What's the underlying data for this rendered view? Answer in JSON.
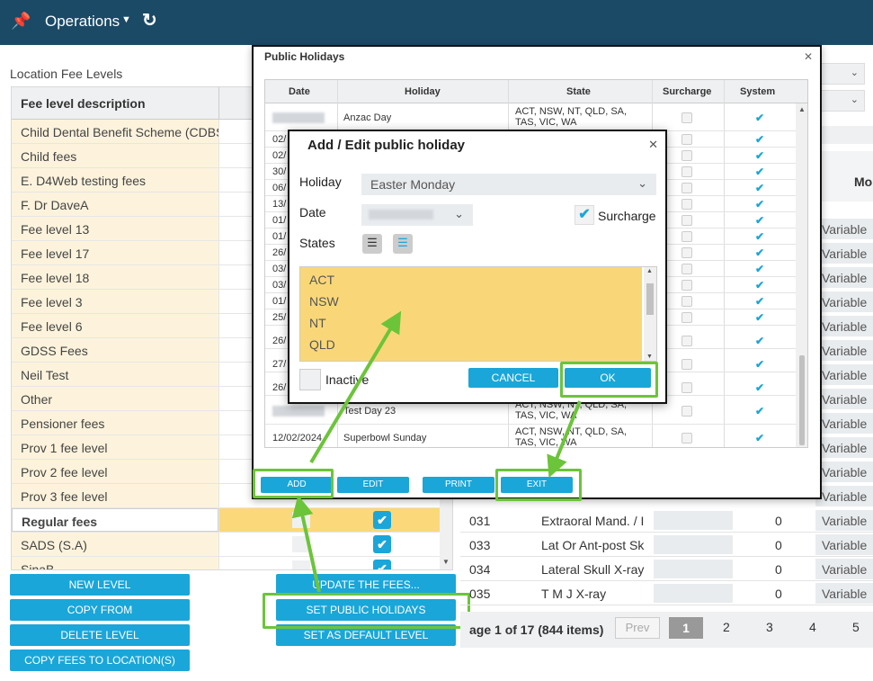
{
  "topbar": {
    "menu": "Operations"
  },
  "location_title": "Location Fee Levels",
  "fee_table": {
    "header": "Fee level description",
    "rows": [
      "Child Dental Benefit Scheme (CDBS)",
      "Child fees",
      "E. D4Web testing fees",
      "F. Dr DaveA",
      "Fee level 13",
      "Fee level 17",
      "Fee level 18",
      "Fee level 3",
      "Fee level 6",
      "GDSS Fees",
      "Neil Test",
      "Other",
      "Pensioner fees",
      "Prov 1 fee level",
      "Prov 2 fee level",
      "Prov 3 fee level",
      "Regular fees",
      "SADS (S.A)",
      "SinaB"
    ],
    "selected": "Regular fees"
  },
  "left_buttons": [
    "NEW LEVEL",
    "COPY FROM",
    "DELETE LEVEL",
    "COPY FEES TO LOCATION(S)"
  ],
  "mid_buttons": [
    "UPDATE THE FEES...",
    "SET PUBLIC HOLIDAYS",
    "SET AS DEFAULT LEVEL"
  ],
  "right_panel": {
    "col_header": "Mo",
    "var_label": "Variable",
    "rows": [
      {
        "code": "031",
        "name": "Extraoral Mand. / I",
        "qty": "0",
        "type": "Variable"
      },
      {
        "code": "033",
        "name": "Lat Or Ant-post Sk",
        "qty": "0",
        "type": "Variable"
      },
      {
        "code": "034",
        "name": "Lateral Skull X-ray",
        "qty": "0",
        "type": "Variable"
      },
      {
        "code": "035",
        "name": "T M J X-ray",
        "qty": "0",
        "type": "Variable"
      }
    ]
  },
  "pager": {
    "text": "age 1 of 17 (844 items)",
    "prev": "Prev",
    "pages": [
      "1",
      "2",
      "3",
      "4",
      "5"
    ]
  },
  "holidays_dialog": {
    "title": "Public Holidays",
    "columns": [
      "Date",
      "Holiday",
      "State",
      "Surcharge",
      "System"
    ],
    "rows": [
      {
        "date": "",
        "holiday": "Anzac Day",
        "state": "ACT, NSW, NT, QLD, SA, TAS, VIC, WA"
      },
      {
        "date": "",
        "holiday": "Test Day 23",
        "state": "ACT, NSW, NT, QLD, SA, TAS, VIC, WA"
      },
      {
        "date": "12/02/2024",
        "holiday": "Superbowl Sunday",
        "state": "ACT, NSW, NT, QLD, SA, TAS, VIC, WA"
      }
    ],
    "partial_dates": [
      "02/",
      "02/",
      "30/",
      "06/",
      "13/",
      "01/",
      "01/",
      "26/",
      "03/",
      "03/",
      "01/",
      "25/",
      "26/",
      "27/",
      "26/"
    ],
    "buttons": [
      "ADD",
      "EDIT",
      "PRINT",
      "EXIT"
    ]
  },
  "edit_dialog": {
    "title": "Add / Edit public holiday",
    "holiday_label": "Holiday",
    "holiday_value": "Easter Monday",
    "date_label": "Date",
    "surcharge_label": "Surcharge",
    "states_label": "States",
    "states": [
      "ACT",
      "NSW",
      "NT",
      "QLD"
    ],
    "inactive_label": "Inactive",
    "cancel": "CANCEL",
    "ok": "OK"
  },
  "colors": {
    "topbar": "#1b4a67",
    "accent": "#1aa6d8",
    "highlight": "#f9d779",
    "annotation": "#6cc43a"
  }
}
